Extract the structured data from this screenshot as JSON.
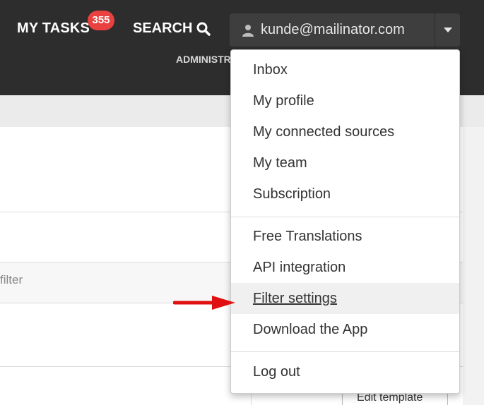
{
  "header": {
    "my_tasks": "MY TASKS",
    "tasks_count": "355",
    "search": "SEARCH",
    "user_email": "kunde@mailinator.com",
    "admin_link": "ADMINISTRATION"
  },
  "user_menu": {
    "items": [
      {
        "label": "Inbox"
      },
      {
        "label": "My profile"
      },
      {
        "label": "My connected sources"
      },
      {
        "label": "My team"
      },
      {
        "label": "Subscription"
      },
      {
        "label": "Free Translations"
      },
      {
        "label": "API integration"
      },
      {
        "label": "Filter settings"
      },
      {
        "label": "Download the App"
      },
      {
        "label": "Log out"
      }
    ],
    "highlighted": "Filter settings"
  },
  "content": {
    "filter_text": "filter",
    "edit_template": "Edit template"
  },
  "colors": {
    "topbar": "#2d2d2d",
    "badge": "#e94040",
    "arrow": "#e01010"
  }
}
